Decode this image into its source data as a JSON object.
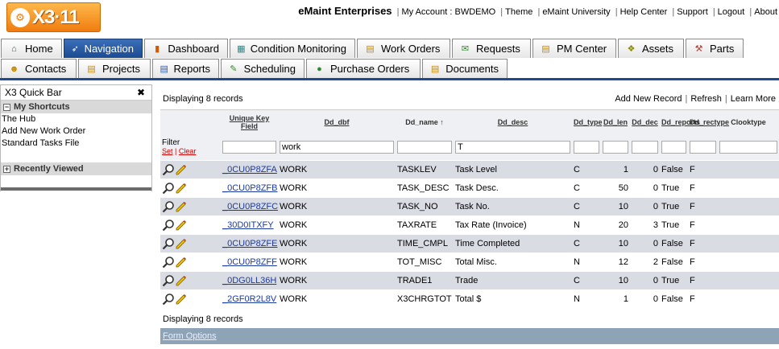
{
  "header": {
    "logo_text": "X3",
    "logo_version": "11",
    "company": "eMaint Enterprises",
    "links": [
      "My Account : BWDEMO",
      "Theme",
      "eMaint University",
      "Help Center",
      "Support",
      "Logout",
      "About"
    ]
  },
  "tabs_row1": [
    {
      "label": "Home",
      "icon": "home-icon"
    },
    {
      "label": "Navigation",
      "icon": "navigation-icon",
      "active": true
    },
    {
      "label": "Dashboard",
      "icon": "dashboard-icon"
    },
    {
      "label": "Condition Monitoring",
      "icon": "monitor-icon"
    },
    {
      "label": "Work Orders",
      "icon": "work-order-icon"
    },
    {
      "label": "Requests",
      "icon": "request-icon"
    },
    {
      "label": "PM Center",
      "icon": "pm-icon"
    },
    {
      "label": "Assets",
      "icon": "assets-icon"
    },
    {
      "label": "Parts",
      "icon": "parts-icon"
    }
  ],
  "tabs_row2": [
    {
      "label": "Contacts",
      "icon": "contacts-icon"
    },
    {
      "label": "Projects",
      "icon": "projects-icon"
    },
    {
      "label": "Reports",
      "icon": "reports-icon"
    },
    {
      "label": "Scheduling",
      "icon": "scheduling-icon"
    },
    {
      "label": "Purchase Orders",
      "icon": "purchase-icon"
    },
    {
      "label": "Documents",
      "icon": "documents-icon"
    }
  ],
  "quickbar": {
    "title": "X3 Quick Bar",
    "close": "✖",
    "shortcuts_label": "My Shortcuts",
    "shortcuts": [
      "The Hub",
      "Add New Work Order",
      "Standard Tasks File"
    ],
    "recent_label": "Recently Viewed"
  },
  "grid": {
    "display_text": "Displaying 8 records",
    "actions": [
      "Add New Record",
      "Refresh",
      "Learn More"
    ],
    "columns": [
      "Unique Key Field",
      "Dd_dbf",
      "Dd_name ↑",
      "Dd_desc",
      "Dd_type",
      "Dd_len",
      "Dd_dec",
      "Dd_reports",
      "Dd_rectype",
      "Clooktype"
    ],
    "filter_label": "Filter",
    "filter_set": "Set",
    "filter_clear": "Clear",
    "filters": [
      "",
      "work",
      "",
      "T",
      "",
      "",
      "",
      "",
      "",
      ""
    ],
    "rows": [
      [
        "_0CU0P8ZFA",
        "WORK",
        "TASKLEV",
        "Task Level",
        "C",
        "1",
        "0",
        "False",
        "F",
        ""
      ],
      [
        "_0CU0P8ZFB",
        "WORK",
        "TASK_DESC",
        "Task Desc.",
        "C",
        "50",
        "0",
        "True",
        "F",
        ""
      ],
      [
        "_0CU0P8ZFC",
        "WORK",
        "TASK_NO",
        "Task No.",
        "C",
        "10",
        "0",
        "True",
        "F",
        ""
      ],
      [
        "_30D0ITXFY",
        "WORK",
        "TAXRATE",
        "Tax Rate (Invoice)",
        "N",
        "20",
        "3",
        "True",
        "F",
        ""
      ],
      [
        "_0CU0P8ZFE",
        "WORK",
        "TIME_CMPL",
        "Time Completed",
        "C",
        "10",
        "0",
        "False",
        "F",
        ""
      ],
      [
        "_0CU0P8ZFF",
        "WORK",
        "TOT_MISC",
        "Total Misc.",
        "N",
        "12",
        "2",
        "False",
        "F",
        ""
      ],
      [
        "_0DG0LL36H",
        "WORK",
        "TRADE1",
        "Trade",
        "C",
        "10",
        "0",
        "True",
        "F",
        ""
      ],
      [
        "_2GF0R2L8V",
        "WORK",
        "X3CHRGTOT",
        "Total $",
        "N",
        "1",
        "0",
        "False",
        "F",
        ""
      ]
    ],
    "footer_text": "Displaying 8 records",
    "form_options": "Form Options"
  }
}
